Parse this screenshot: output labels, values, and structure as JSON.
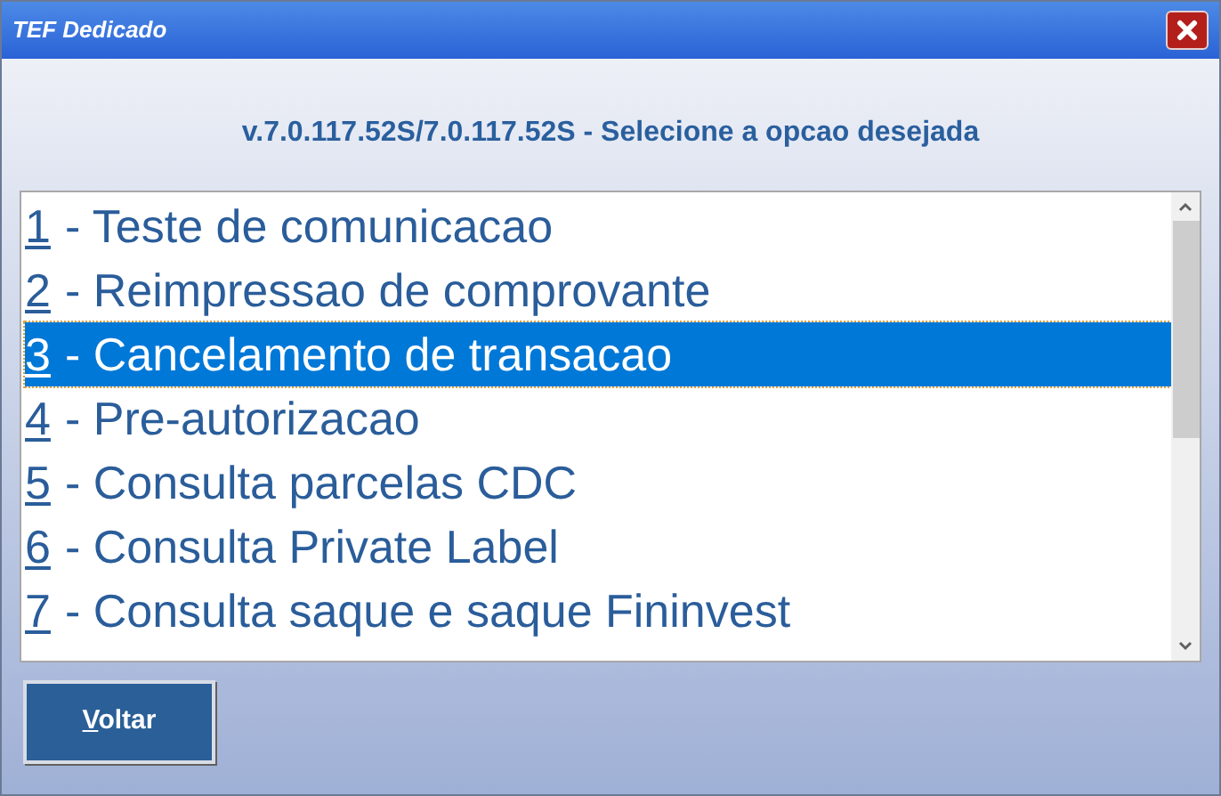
{
  "window": {
    "title": "TEF Dedicado"
  },
  "heading": "v.7.0.117.52S/7.0.117.52S - Selecione a opcao desejada",
  "options": [
    {
      "key": "1",
      "label": "- Teste de comunicacao",
      "selected": false
    },
    {
      "key": "2",
      "label": "- Reimpressao de comprovante",
      "selected": false
    },
    {
      "key": "3",
      "label": "- Cancelamento de transacao",
      "selected": true
    },
    {
      "key": "4",
      "label": "- Pre-autorizacao",
      "selected": false
    },
    {
      "key": "5",
      "label": "- Consulta parcelas CDC",
      "selected": false
    },
    {
      "key": "6",
      "label": "- Consulta Private Label",
      "selected": false
    },
    {
      "key": "7",
      "label": "- Consulta saque e saque Fininvest",
      "selected": false
    }
  ],
  "button": {
    "mnemonic": "V",
    "label_rest": "oltar"
  }
}
